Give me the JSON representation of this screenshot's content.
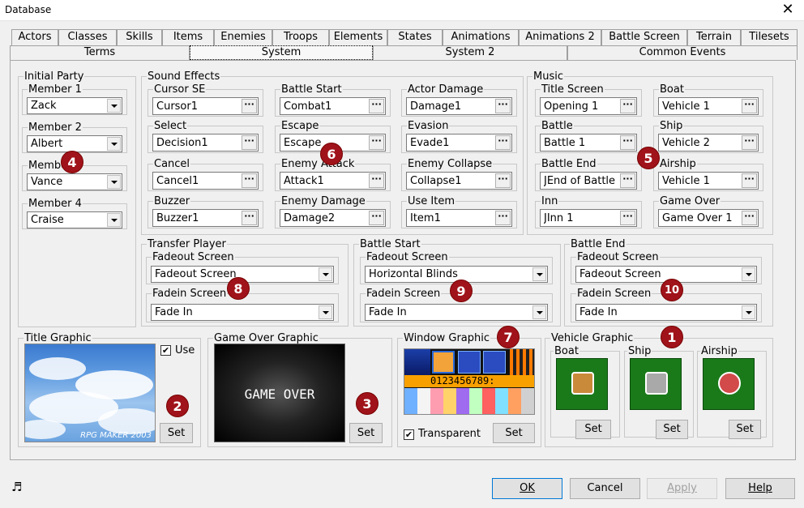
{
  "window": {
    "title": "Database",
    "close": "✕"
  },
  "tabs_row1": [
    "Actors",
    "Classes",
    "Skills",
    "Items",
    "Enemies",
    "Troops",
    "Elements",
    "States",
    "Animations",
    "Animations 2",
    "Battle Screen",
    "Terrain",
    "Tilesets"
  ],
  "tabs_row2": [
    "Terms",
    "System",
    "System 2",
    "Common Events"
  ],
  "initial_party": {
    "legend": "Initial Party",
    "members": [
      {
        "label": "Member 1",
        "value": "Zack"
      },
      {
        "label": "Member 2",
        "value": "Albert"
      },
      {
        "label": "Member 3",
        "value": "Vance"
      },
      {
        "label": "Member 4",
        "value": "Craise"
      }
    ]
  },
  "sound_effects": {
    "legend": "Sound Effects",
    "fields": [
      {
        "label": "Cursor SE",
        "value": "Cursor1"
      },
      {
        "label": "Battle Start",
        "value": "Combat1"
      },
      {
        "label": "Actor Damage",
        "value": "Damage1"
      },
      {
        "label": "Select",
        "value": "Decision1"
      },
      {
        "label": "Escape",
        "value": "Escape"
      },
      {
        "label": "Evasion",
        "value": "Evade1"
      },
      {
        "label": "Cancel",
        "value": "Cancel1"
      },
      {
        "label": "Enemy Attack",
        "value": "Attack1"
      },
      {
        "label": "Enemy Collapse",
        "value": "Collapse1"
      },
      {
        "label": "Buzzer",
        "value": "Buzzer1"
      },
      {
        "label": "Enemy Damage",
        "value": "Damage2"
      },
      {
        "label": "Use Item",
        "value": "Item1"
      }
    ]
  },
  "music": {
    "legend": "Music",
    "fields": [
      {
        "label": "Title Screen",
        "value": "Opening 1"
      },
      {
        "label": "Boat",
        "value": "Vehicle 1"
      },
      {
        "label": "Battle",
        "value": "Battle 1"
      },
      {
        "label": "Ship",
        "value": "Vehicle 2"
      },
      {
        "label": "Battle End",
        "value": "JEnd of Battle 1"
      },
      {
        "label": "Airship",
        "value": "Vehicle 1"
      },
      {
        "label": "Inn",
        "value": "JInn 1"
      },
      {
        "label": "Game Over",
        "value": "Game Over 1"
      }
    ]
  },
  "transfer_player": {
    "legend": "Transfer Player",
    "fadeout_label": "Fadeout Screen",
    "fadeout_value": "Fadeout Screen",
    "fadein_label": "Fadein Screen",
    "fadein_value": "Fade In"
  },
  "battle_start": {
    "legend": "Battle Start",
    "fadeout_label": "Fadeout Screen",
    "fadeout_value": "Horizontal Blinds",
    "fadein_label": "Fadein Screen",
    "fadein_value": "Fade In"
  },
  "battle_end": {
    "legend": "Battle End",
    "fadeout_label": "Fadeout Screen",
    "fadeout_value": "Fadeout Screen",
    "fadein_label": "Fadein Screen",
    "fadein_value": "Fade In"
  },
  "title_graphic": {
    "legend": "Title Graphic",
    "use_label": "Use",
    "use_checked": true,
    "set_label": "Set",
    "watermark": "RPG MAKER 2003"
  },
  "gameover_graphic": {
    "legend": "Game Over Graphic",
    "image_text": "GAME OVER",
    "set_label": "Set"
  },
  "window_graphic": {
    "legend": "Window Graphic",
    "transparent_label": "Transparent",
    "transparent_checked": true,
    "set_label": "Set",
    "digits": "0123456789:"
  },
  "vehicle_graphic": {
    "legend": "Vehicle Graphic",
    "vehicles": [
      {
        "label": "Boat",
        "set": "Set"
      },
      {
        "label": "Ship",
        "set": "Set"
      },
      {
        "label": "Airship",
        "set": "Set"
      }
    ]
  },
  "badges": [
    "1",
    "2",
    "3",
    "4",
    "5",
    "6",
    "7",
    "8",
    "9",
    "10"
  ],
  "footer": {
    "ok": "OK",
    "cancel": "Cancel",
    "apply": "Apply",
    "help": "Help",
    "music_icon": "♬"
  },
  "checkmark": "✔",
  "dots": "···"
}
